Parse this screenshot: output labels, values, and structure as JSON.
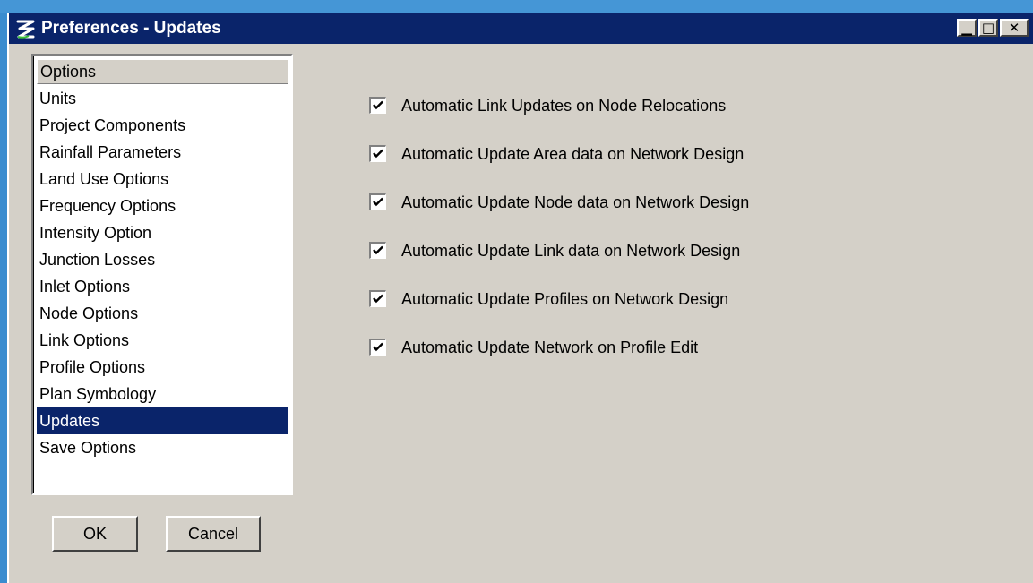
{
  "window": {
    "title": "Preferences - Updates",
    "controls": {
      "minimize": "▁",
      "maximize": "□",
      "close": "✕"
    }
  },
  "sidebar": {
    "header": "Options",
    "items": [
      {
        "label": "Units"
      },
      {
        "label": "Project Components"
      },
      {
        "label": "Rainfall Parameters"
      },
      {
        "label": "Land Use Options"
      },
      {
        "label": "Frequency Options"
      },
      {
        "label": "Intensity Option"
      },
      {
        "label": "Junction Losses"
      },
      {
        "label": "Inlet Options"
      },
      {
        "label": "Node Options"
      },
      {
        "label": "Link Options"
      },
      {
        "label": "Profile Options"
      },
      {
        "label": "Plan Symbology"
      },
      {
        "label": "Updates",
        "selected": true
      },
      {
        "label": "Save Options"
      }
    ]
  },
  "buttons": {
    "ok": "OK",
    "cancel": "Cancel"
  },
  "options": [
    {
      "label": "Automatic Link Updates on Node Relocations",
      "checked": true
    },
    {
      "label": "Automatic Update Area data on Network Design",
      "checked": true
    },
    {
      "label": "Automatic Update Node data on Network Design",
      "checked": true
    },
    {
      "label": "Automatic Update Link data on Network Design",
      "checked": true
    },
    {
      "label": "Automatic Update Profiles on Network Design",
      "checked": true
    },
    {
      "label": "Automatic Update Network on Profile Edit",
      "checked": true
    }
  ],
  "colors": {
    "titlebar": "#0a246a",
    "window_face": "#d4d0c8",
    "selection": "#0a246a",
    "desktop": "#3a8ccf"
  }
}
